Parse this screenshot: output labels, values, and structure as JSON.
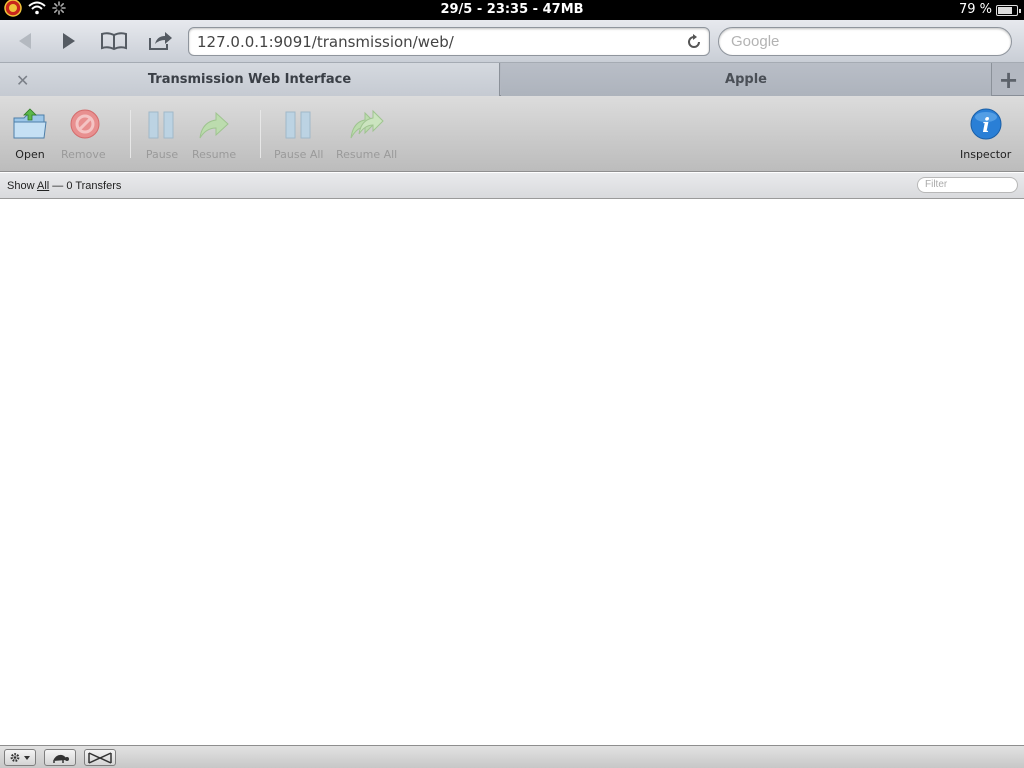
{
  "status_bar": {
    "center_text": "29/5 - 23:35 - 47MB",
    "battery_text": "79 %",
    "battery_level": 0.79
  },
  "browser": {
    "url": "127.0.0.1:9091/transmission/web/",
    "search_placeholder": "Google",
    "tabs": [
      {
        "title": "Transmission Web Interface",
        "active": true
      },
      {
        "title": "Apple",
        "active": false
      }
    ]
  },
  "toolbar": {
    "open": "Open",
    "remove": "Remove",
    "pause": "Pause",
    "resume": "Resume",
    "pause_all": "Pause All",
    "resume_all": "Resume All",
    "inspector": "Inspector"
  },
  "filter_bar": {
    "show_label": "Show",
    "all_link": "All",
    "separator": "—",
    "transfers": "0 Transfers",
    "filter_placeholder": "Filter"
  },
  "colors": {
    "inspector_blue": "#2a7fd6",
    "remove_red": "#e25b5b",
    "resume_green": "#8fbf7a"
  }
}
